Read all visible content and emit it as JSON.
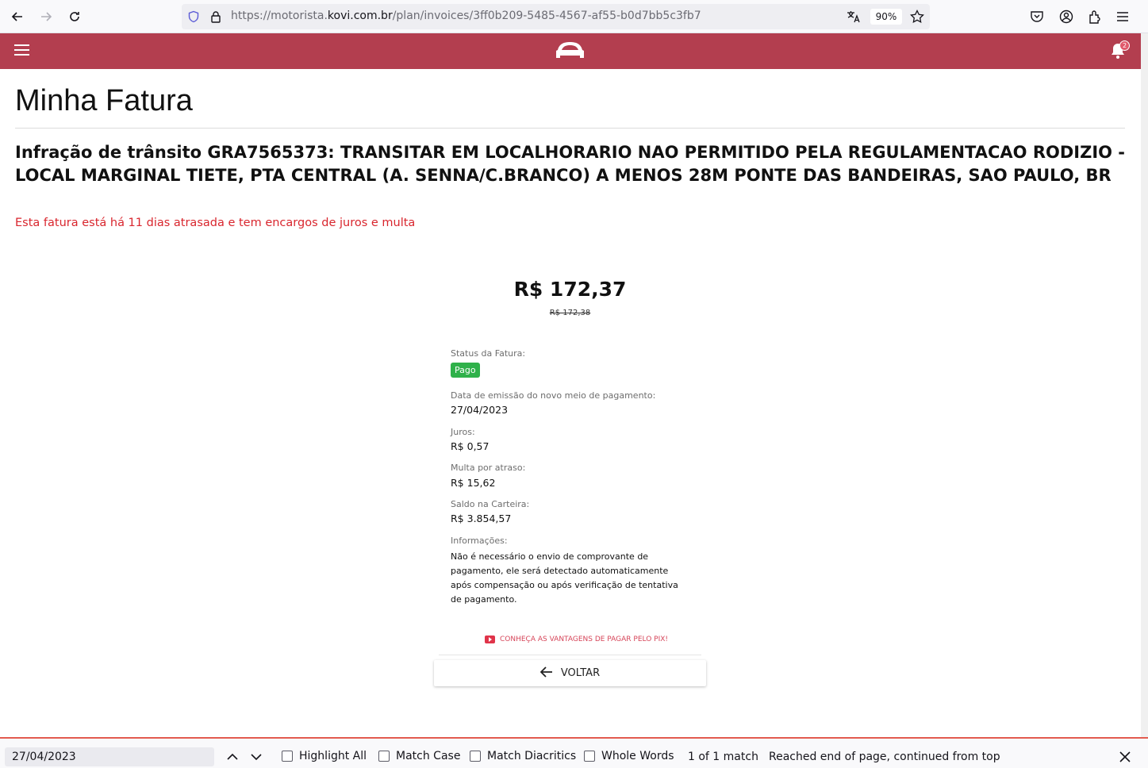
{
  "browser": {
    "url_prefix": "https://motorista.",
    "url_host": "kovi.com.br",
    "url_path": "/plan/invoices/3ff0b209-5485-4567-af55-b0d7bb5c3fb7",
    "zoom": "90%"
  },
  "header": {
    "notification_count": "2"
  },
  "page": {
    "title": "Minha Fatura",
    "description": "Infração de trânsito GRA7565373: TRANSITAR EM LOCALHORARIO NAO PERMITIDO PELA REGULAMENTACAO RODIZIO - LOCAL MARGINAL TIETE, PTA CENTRAL (A. SENNA/C.BRANCO) A MENOS 28M PONTE DAS BANDEIRAS, SAO PAULO, BR",
    "overdue_message": "Esta fatura está há 11 dias atrasada e tem encargos de juros e multa",
    "amount": "R$ 172,37",
    "old_amount": "R$ 172,38"
  },
  "details": {
    "status_label": "Status da Fatura:",
    "status_value": "Pago",
    "issue_date_label": "Data de emissão do novo meio de pagamento:",
    "issue_date_value": "27/04/2023",
    "interest_label": "Juros:",
    "interest_value": "R$ 0,57",
    "late_fee_label": "Multa por atraso:",
    "late_fee_value": "R$ 15,62",
    "wallet_label": "Saldo na Carteira:",
    "wallet_value": "R$ 3.854,57",
    "info_label": "Informações:",
    "info_value": "Não é necessário o envio de comprovante de pagamento, ele será detectado automaticamente após compensação ou após verificação de tentativa de pagamento."
  },
  "actions": {
    "pix_link": "CONHEÇA AS VANTAGENS DE PAGAR PELO PIX!",
    "back_label": "VOLTAR"
  },
  "colors": {
    "header": "#b33e4f",
    "overdue": "#d9262e",
    "status_paid": "#2fb14a",
    "pix_link": "#d64559"
  },
  "find_bar": {
    "query": "27/04/2023",
    "highlight_all": "Highlight All",
    "match_case": "Match Case",
    "match_diacritics": "Match Diacritics",
    "whole_words": "Whole Words",
    "match_count": "1 of 1 match",
    "status": "Reached end of page, continued from top"
  }
}
